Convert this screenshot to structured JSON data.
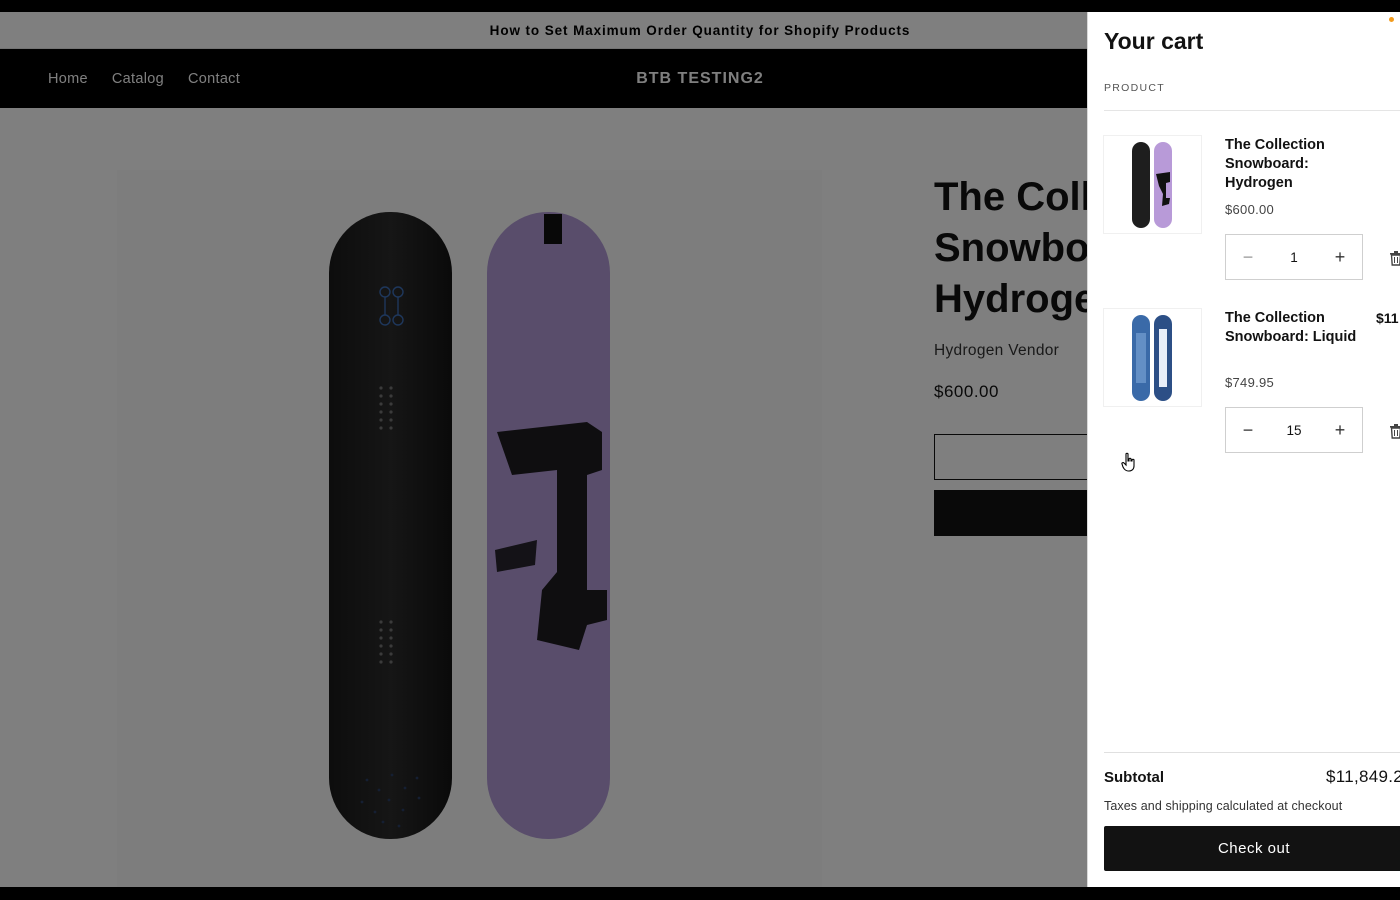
{
  "announcement": {
    "text": "How to Set Maximum Order Quantity for Shopify Products"
  },
  "header": {
    "nav": [
      "Home",
      "Catalog",
      "Contact"
    ],
    "brand": "BTB TESTING2"
  },
  "product": {
    "title": "The Collection Snowboard: Hydrogen",
    "vendor": "Hydrogen Vendor",
    "price": "$600.00"
  },
  "cart": {
    "title": "Your cart",
    "column_header": "PRODUCT",
    "items": [
      {
        "name": "The Collection Snowboard: Hydrogen",
        "price": "$600.00",
        "quantity": "1",
        "line_total": ""
      },
      {
        "name": "The Collection Snowboard: Liquid",
        "price": "$749.95",
        "quantity": "15",
        "line_total": "$11"
      }
    ],
    "decrement_symbol": "−",
    "increment_symbol": "+",
    "subtotal_label": "Subtotal",
    "subtotal_value": "$11,849.2",
    "taxes_note": "Taxes and shipping calculated at checkout",
    "checkout_label": "Check out"
  },
  "colors": {
    "accent_dot": "#f29b1d",
    "button_dark": "#121212",
    "hydrogen_purple": "#b89ad8"
  },
  "icons": [
    "trash-icon",
    "pointer-hand-icon",
    "minus-icon",
    "plus-icon"
  ]
}
